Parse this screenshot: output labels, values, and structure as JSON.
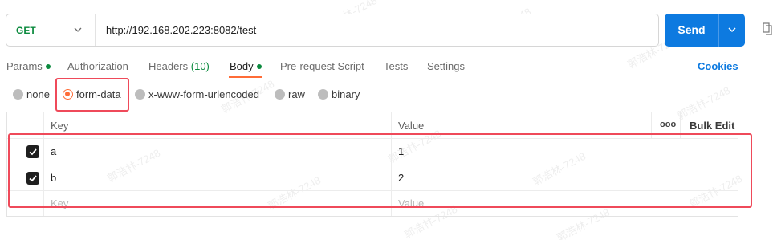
{
  "request": {
    "method": "GET",
    "url": "http://192.168.202.223:8082/test",
    "send_label": "Send"
  },
  "tabs": [
    {
      "label": "Params",
      "dot": true
    },
    {
      "label": "Authorization"
    },
    {
      "label": "Headers",
      "count": "(10)"
    },
    {
      "label": "Body",
      "dot": true,
      "active": true
    },
    {
      "label": "Pre-request Script"
    },
    {
      "label": "Tests"
    },
    {
      "label": "Settings"
    }
  ],
  "cookies_label": "Cookies",
  "body_types": [
    {
      "label": "none",
      "selected": false
    },
    {
      "label": "form-data",
      "selected": true
    },
    {
      "label": "x-www-form-urlencoded",
      "selected": false
    },
    {
      "label": "raw",
      "selected": false
    },
    {
      "label": "binary",
      "selected": false
    }
  ],
  "table": {
    "headers": {
      "key": "Key",
      "value": "Value",
      "bulk_edit": "Bulk Edit",
      "more": "ooo"
    },
    "rows": [
      {
        "checked": true,
        "key": "a",
        "value": "1"
      },
      {
        "checked": true,
        "key": "b",
        "value": "2"
      }
    ],
    "placeholder": {
      "key": "Key",
      "value": "Value"
    }
  },
  "watermark": "郭浩林-7248",
  "colors": {
    "accent_orange": "#ff6c37",
    "send_blue": "#0d7ae0",
    "method_green": "#0b8a3e",
    "annotation_red": "#ef4a5a"
  }
}
